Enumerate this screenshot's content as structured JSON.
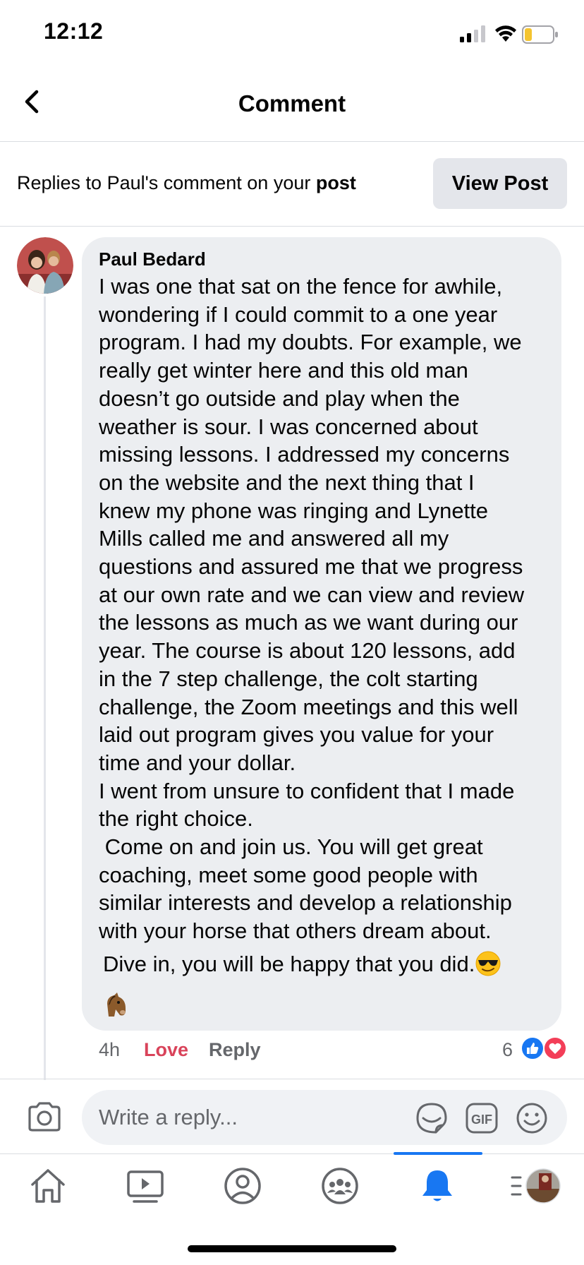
{
  "status_bar": {
    "time": "12:12"
  },
  "header": {
    "title": "Comment"
  },
  "banner": {
    "text_prefix": "Replies to Paul's comment on your ",
    "text_bold": "post",
    "view_post_label": "View Post"
  },
  "comment": {
    "author": "Paul Bedard",
    "body": "I was one that sat on the fence for awhile,\nwondering if I could commit to a one year\nprogram. I had my doubts. For example, we\nreally get winter here and this old man\ndoesn’t go outside and play when the\nweather is sour. I was concerned about\nmissing lessons. I addressed my concerns\non the website and the next thing that I\nknew my phone was ringing and Lynette\nMills called me and answered all my\nquestions and assured me that we progress\nat our own rate and we can view and review\nthe lessons as much as we want during our\nyear. The course is about 120 lessons, add\nin the 7 step challenge, the colt starting\nchallenge, the Zoom meetings and this well\nlaid out program gives you value for your\ntime and your dollar.\nI went from unsure to confident that I made\nthe right choice.\n Come on and join us. You will get great\ncoaching, meet some good people with\nsimilar interests and develop a relationship\nwith your horse that others dream about.",
    "closing": "Dive in, you will be happy that you did.",
    "closing_emoji": "smiling-face-with-sunglasses",
    "extra_emoji": "horse-face",
    "time": "4h",
    "love_label": "Love",
    "reply_label": "Reply",
    "reaction_count": "6",
    "reactions": [
      "like",
      "love"
    ]
  },
  "composer": {
    "placeholder": "Write a reply..."
  },
  "nav": {
    "items": [
      "home",
      "watch",
      "profile",
      "groups",
      "notifications",
      "menu"
    ],
    "active": "notifications"
  },
  "colors": {
    "accent": "#1877f2",
    "love": "#d9435a",
    "bubble": "#eceef1",
    "secondary_text": "#65676b"
  }
}
